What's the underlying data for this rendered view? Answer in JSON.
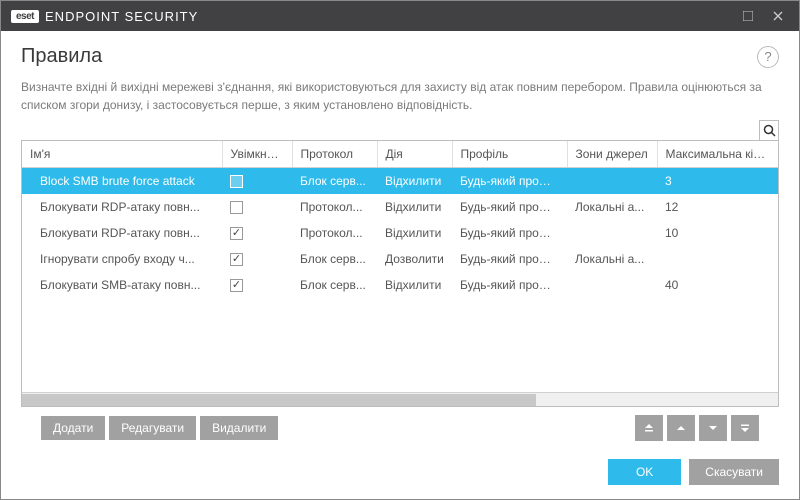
{
  "titlebar": {
    "brand": "eset",
    "product": "ENDPOINT SECURITY"
  },
  "header": {
    "title": "Правила",
    "help": "?"
  },
  "description": "Визначте вхідні й вихідні мережеві з'єднання, які використовуються для захисту від атак повним перебором. Правила оцінюються за списком згори донизу, і застосовується перше, з яким установлено відповідність.",
  "columns": {
    "name": "Ім'я",
    "enabled": "Увімкнуто",
    "protocol": "Протокол",
    "action": "Дія",
    "profile": "Профіль",
    "zones": "Зони джерел",
    "max": "Максимальна кількість сп..."
  },
  "rows": [
    {
      "name": "Block SMB brute force attack",
      "enabled": false,
      "protocol": "Блок серв...",
      "action": "Відхилити",
      "profile": "Будь-який профіль",
      "zones": "",
      "max": "3",
      "selected": true
    },
    {
      "name": "Блокувати RDP-атаку повн...",
      "enabled": false,
      "protocol": "Протокол...",
      "action": "Відхилити",
      "profile": "Будь-який профіль",
      "zones": "Локальні а...",
      "max": "12",
      "selected": false
    },
    {
      "name": "Блокувати RDP-атаку повн...",
      "enabled": true,
      "protocol": "Протокол...",
      "action": "Відхилити",
      "profile": "Будь-який профіль",
      "zones": "",
      "max": "10",
      "selected": false
    },
    {
      "name": "Ігнорувати спробу входу ч...",
      "enabled": true,
      "protocol": "Блок серв...",
      "action": "Дозволити",
      "profile": "Будь-який профіль",
      "zones": "Локальні а...",
      "max": "",
      "selected": false
    },
    {
      "name": "Блокувати SMB-атаку повн...",
      "enabled": true,
      "protocol": "Блок серв...",
      "action": "Відхилити",
      "profile": "Будь-який профіль",
      "zones": "",
      "max": "40",
      "selected": false
    }
  ],
  "buttons": {
    "add": "Додати",
    "edit": "Редагувати",
    "delete": "Видалити"
  },
  "footer": {
    "ok": "OK",
    "cancel": "Скасувати"
  }
}
